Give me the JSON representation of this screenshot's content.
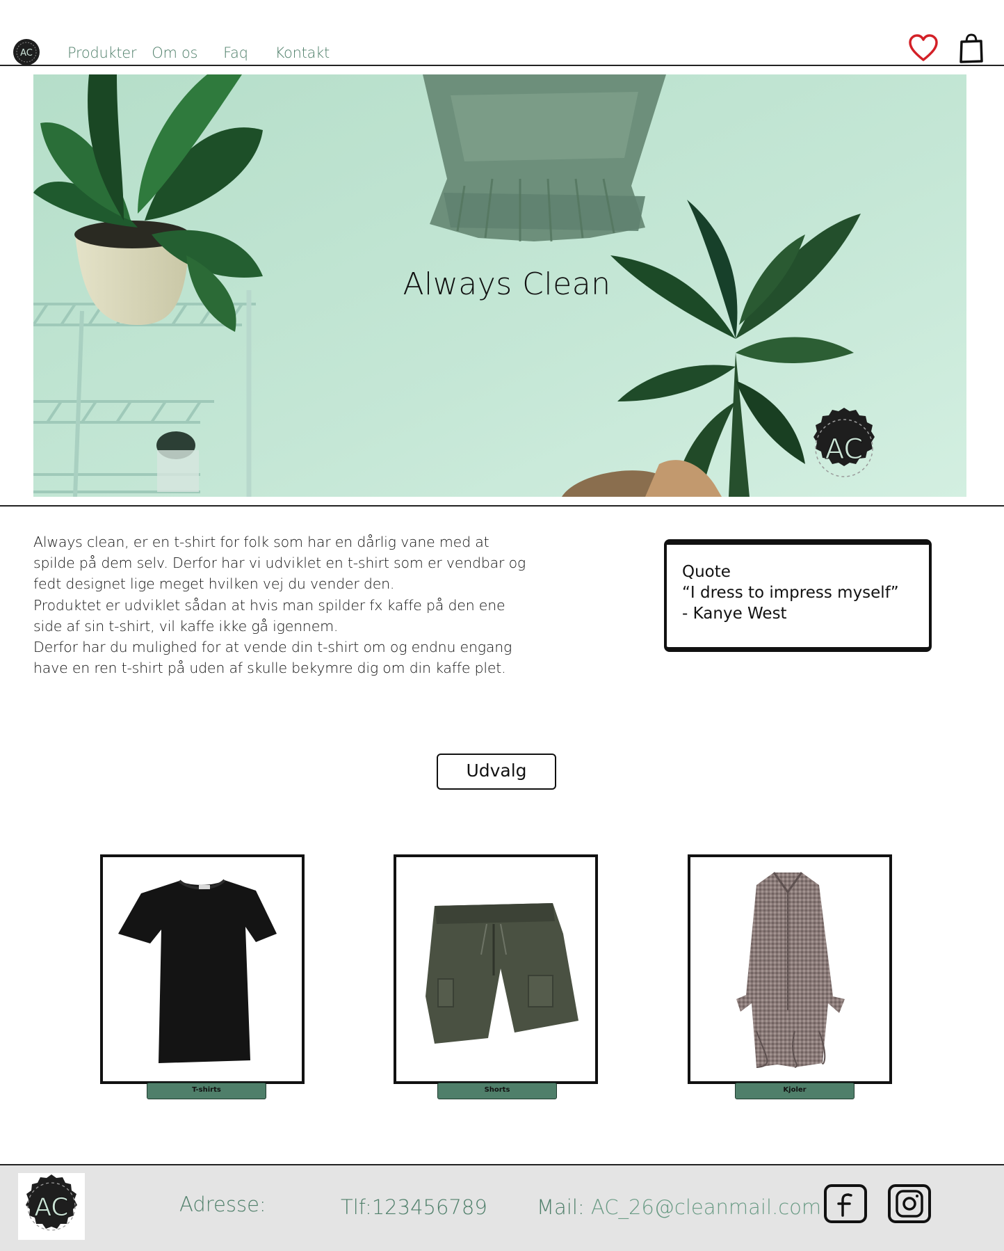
{
  "brand": {
    "logo_text": "AC",
    "colors": {
      "accent": "#4f7f6a",
      "heart": "#d32027",
      "footer_bg": "#e4e4e4"
    }
  },
  "nav": {
    "items": [
      {
        "label": "Produkter"
      },
      {
        "label": "Om os"
      },
      {
        "label": "Faq"
      },
      {
        "label": "Kontakt"
      }
    ],
    "icons": [
      "heart-icon",
      "shopping-bag-icon"
    ]
  },
  "hero": {
    "title": "Always Clean",
    "logo_text": "AC"
  },
  "intro": {
    "paragraphs": [
      "Always clean, er en t-shirt for folk som har en dårlig vane med at spilde på dem selv. Derfor har vi udviklet en t-shirt som er vendbar og fedt designet lige meget hvilken vej du vender den.",
      "Produktet er udviklet sådan at hvis man spilder fx kaffe på den ene side af sin t-shirt, vil kaffe ikke gå igennem.",
      "Derfor har du mulighed for at vende din t-shirt om og endnu engang have en ren t-shirt på uden af skulle bekymre dig om din kaffe plet."
    ]
  },
  "quote": {
    "heading": "Quote",
    "text": "“I dress to impress myself”",
    "author": "- Kanye West"
  },
  "selection": {
    "button_label": "Udvalg",
    "categories": [
      {
        "label": "T-shirts",
        "image": "black-tshirt"
      },
      {
        "label": "Shorts",
        "image": "olive-shorts"
      },
      {
        "label": "Kjoler",
        "image": "checked-dress"
      }
    ]
  },
  "footer": {
    "logo_text": "AC",
    "address_label": "Adresse:",
    "phone": "Tlf:123456789",
    "mail_label": "Mail:",
    "mail_value": "AC_26@cleanmail.com",
    "social": [
      "facebook-icon",
      "instagram-icon"
    ]
  }
}
